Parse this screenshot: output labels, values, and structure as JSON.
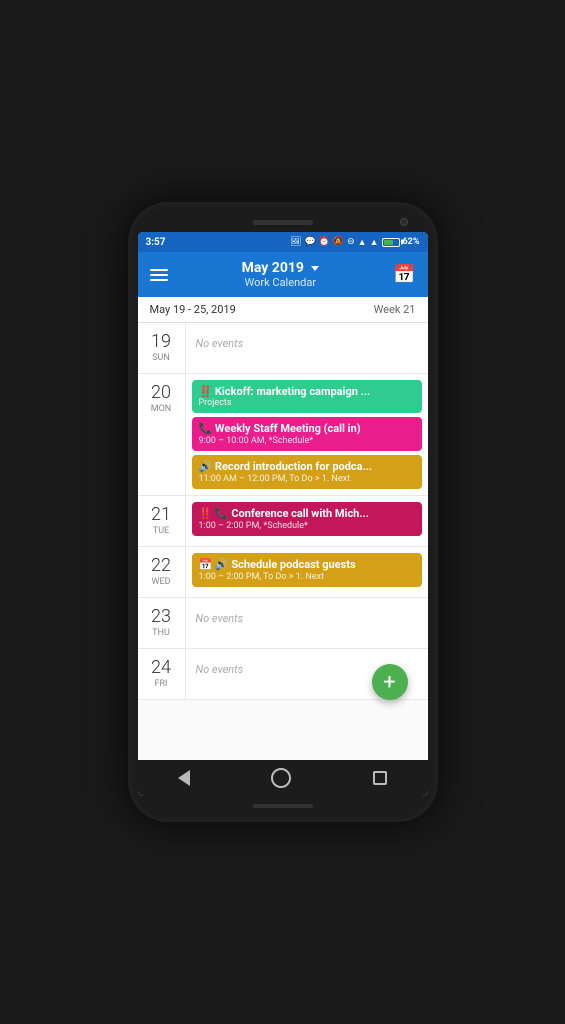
{
  "status_bar": {
    "time": "3:57",
    "battery_percent": "62%"
  },
  "header": {
    "title": "May 2019",
    "subtitle": "Work Calendar",
    "menu_icon": "menu-icon",
    "calendar_icon": "calendar-icon"
  },
  "week": {
    "range": "May 19 - 25, 2019",
    "number": "Week  21"
  },
  "days": [
    {
      "num": "19",
      "name": "Sun",
      "events": []
    },
    {
      "num": "20",
      "name": "Mon",
      "events": [
        {
          "color": "green",
          "title": "‼ Kickoff: marketing campaign ...",
          "tag": "Projects"
        },
        {
          "color": "pink",
          "title": "📞 Weekly Staff Meeting (call in)",
          "subtitle": "9:00 – 10:00 AM, *Schedule*"
        },
        {
          "color": "yellow",
          "title": "🔊 Record introduction for podca...",
          "subtitle": "11:00 AM – 12:00 PM, To Do > 1. Next"
        }
      ]
    },
    {
      "num": "21",
      "name": "Tue",
      "events": [
        {
          "color": "dark-pink",
          "title": "‼ 📞 Conference call with Mich...",
          "subtitle": "1:00 – 2:00 PM, *Schedule*"
        }
      ]
    },
    {
      "num": "22",
      "name": "Wed",
      "events": [
        {
          "color": "yellow",
          "title": "📅 🔊 Schedule podcast guests",
          "subtitle": "1:00 – 2:00 PM, To Do > 1. Next"
        }
      ]
    },
    {
      "num": "23",
      "name": "Thu",
      "events": []
    },
    {
      "num": "24",
      "name": "Fri",
      "events": []
    }
  ],
  "fab": {
    "label": "+"
  },
  "no_events_text": "No events"
}
